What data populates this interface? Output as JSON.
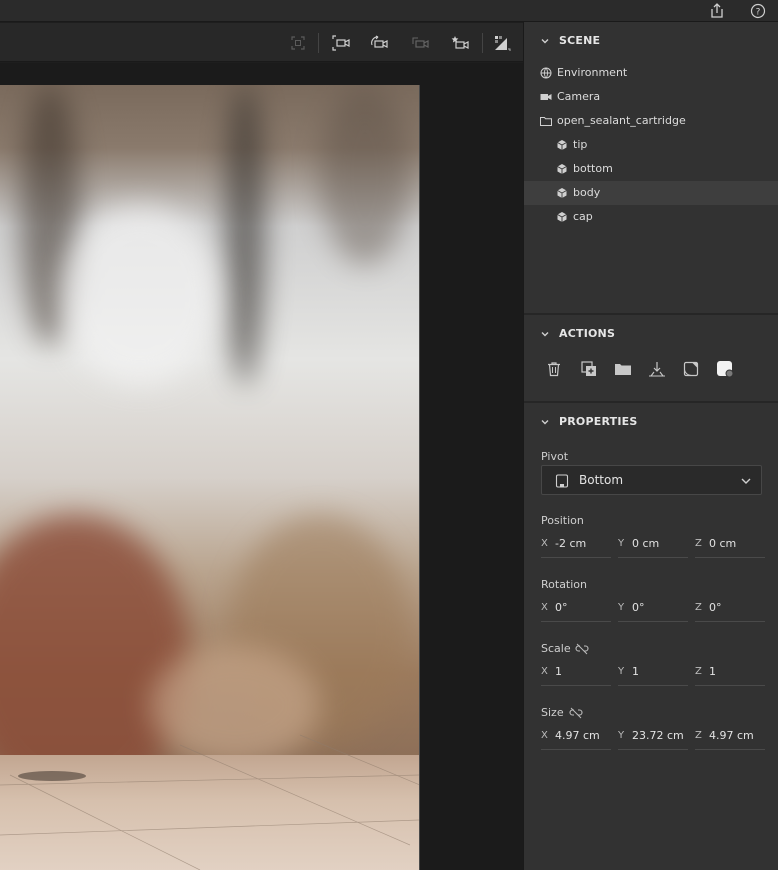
{
  "topbar": {
    "icons": [
      "share-icon",
      "help-icon"
    ]
  },
  "toolbar": {
    "icons": [
      "frame-select-icon",
      "camera-frame-icon",
      "camera-rotate-icon",
      "camera-pan-icon",
      "camera-favorite-icon",
      "render-preview-icon"
    ]
  },
  "scene": {
    "title": "SCENE",
    "items": [
      {
        "label": "Environment",
        "icon": "globe-icon",
        "indent": 0
      },
      {
        "label": "Camera",
        "icon": "camera-icon",
        "indent": 0
      },
      {
        "label": "open_sealant_cartridge",
        "icon": "folder-icon",
        "indent": 0
      },
      {
        "label": "tip",
        "icon": "cube-icon",
        "indent": 1
      },
      {
        "label": "bottom",
        "icon": "cube-icon",
        "indent": 1
      },
      {
        "label": "body",
        "icon": "cube-icon",
        "indent": 1,
        "selected": true
      },
      {
        "label": "cap",
        "icon": "cube-icon",
        "indent": 1
      }
    ]
  },
  "actions": {
    "title": "ACTIONS",
    "icons": [
      "delete-icon",
      "duplicate-icon",
      "group-folder-icon",
      "move-to-ground-icon",
      "apply-material-icon",
      "material-settings-icon"
    ]
  },
  "properties": {
    "title": "PROPERTIES",
    "pivot": {
      "label": "Pivot",
      "value": "Bottom"
    },
    "position": {
      "label": "Position",
      "x": "-2 cm",
      "y": "0 cm",
      "z": "0 cm"
    },
    "rotation": {
      "label": "Rotation",
      "x": "0°",
      "y": "0°",
      "z": "0°"
    },
    "scale": {
      "label": "Scale",
      "x": "1",
      "y": "1",
      "z": "1"
    },
    "size": {
      "label": "Size",
      "x": "4.97 cm",
      "y": "23.72 cm",
      "z": "4.97 cm"
    },
    "axes": {
      "x": "X",
      "y": "Y",
      "z": "Z"
    }
  },
  "colors": {
    "panel_bg": "#323232",
    "selected_row": "#3e3e3e",
    "viewport_bg": "#1b1b1b"
  }
}
